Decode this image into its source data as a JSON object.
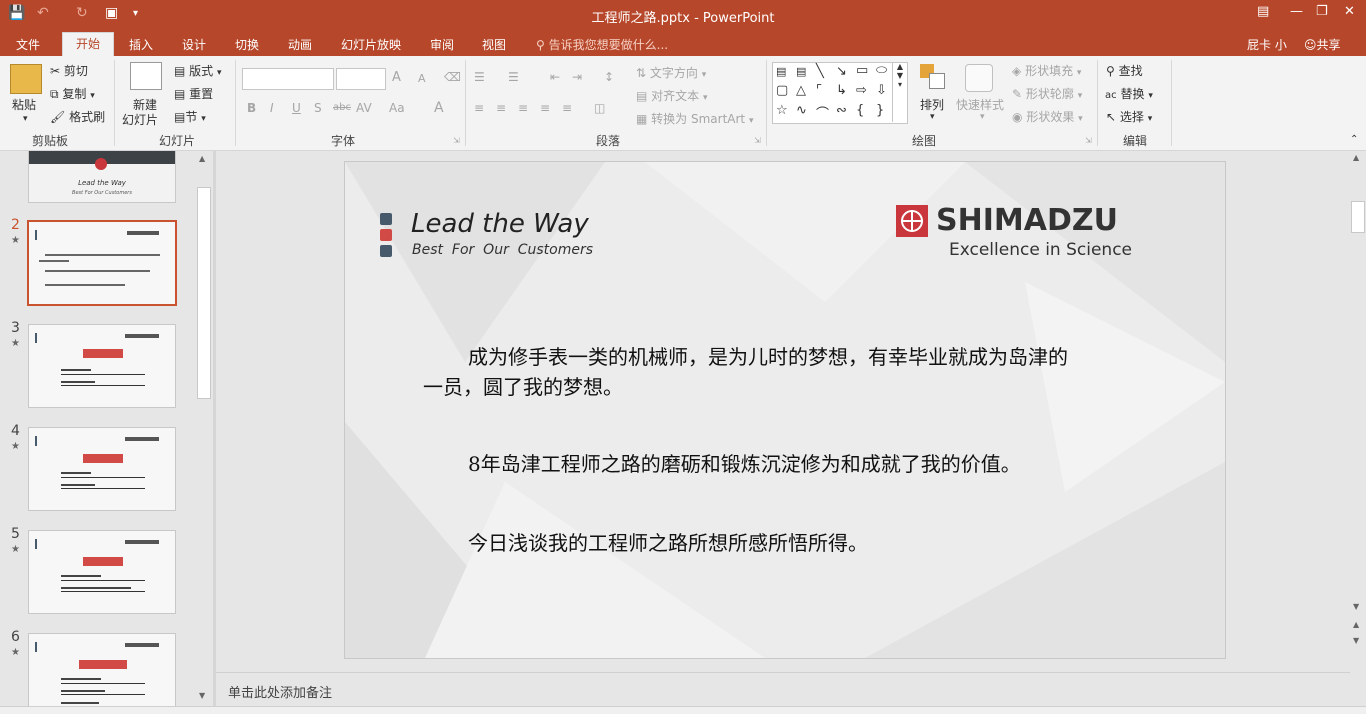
{
  "app": {
    "title": "工程师之路.pptx - PowerPoint",
    "user": "屁卡 小",
    "share": "共享",
    "accent": "#b7472a"
  },
  "tabs": [
    "文件",
    "开始",
    "插入",
    "设计",
    "切换",
    "动画",
    "幻灯片放映",
    "审阅",
    "视图"
  ],
  "active_tab": "开始",
  "tell_me_placeholder": "告诉我您想要做什么...",
  "ribbon": {
    "clipboard": {
      "label": "剪贴板",
      "paste": "粘贴",
      "cut": "剪切",
      "copy": "复制",
      "format_painter": "格式刷"
    },
    "slides": {
      "label": "幻灯片",
      "new_slide": "新建\n幻灯片",
      "new_slide_1": "新建",
      "new_slide_2": "幻灯片",
      "layout": "版式",
      "reset": "重置",
      "section": "节"
    },
    "font": {
      "label": "字体",
      "bold": "B",
      "italic": "I",
      "underline": "U",
      "shadow": "S",
      "strike": "abc",
      "spacing": "AV",
      "case": "Aa",
      "color": "A",
      "grow": "A",
      "shrink": "A"
    },
    "paragraph": {
      "label": "段落",
      "text_direction": "文字方向",
      "align_text": "对齐文本",
      "smartart": "转换为 SmartArt"
    },
    "drawing": {
      "label": "绘图",
      "arrange": "排列",
      "quick_styles": "快速样式",
      "fill": "形状填充",
      "outline": "形状轮廓",
      "effects": "形状效果"
    },
    "editing": {
      "label": "编辑",
      "find": "查找",
      "replace": "替换",
      "select": "选择"
    }
  },
  "thumbnails": [
    {
      "num": "",
      "title": "Lead the Way",
      "subtitle": "Best For Our Customers"
    },
    {
      "num": "2",
      "selected": true
    },
    {
      "num": "3"
    },
    {
      "num": "4"
    },
    {
      "num": "5"
    },
    {
      "num": "6"
    }
  ],
  "slide": {
    "header_title": "Lead the Way",
    "header_subtitle": "Best  For  Our  Customers",
    "logo_name": "SHIMADZU",
    "logo_tagline": "Excellence in Science",
    "para1_line1": "成为修手表一类的机械师，是为儿时的梦想，有幸毕业就成为岛津的",
    "para1_line2": "一员，圆了我的梦想。",
    "para2": "8年岛津工程师之路的磨砺和锻炼沉淀修为和成就了我的价值。",
    "para3": "今日浅谈我的工程师之路所想所感所悟所得。",
    "bullet_colors": [
      "#475a6c",
      "#d24a45",
      "#475a6c"
    ]
  },
  "notes_placeholder": "单击此处添加备注"
}
